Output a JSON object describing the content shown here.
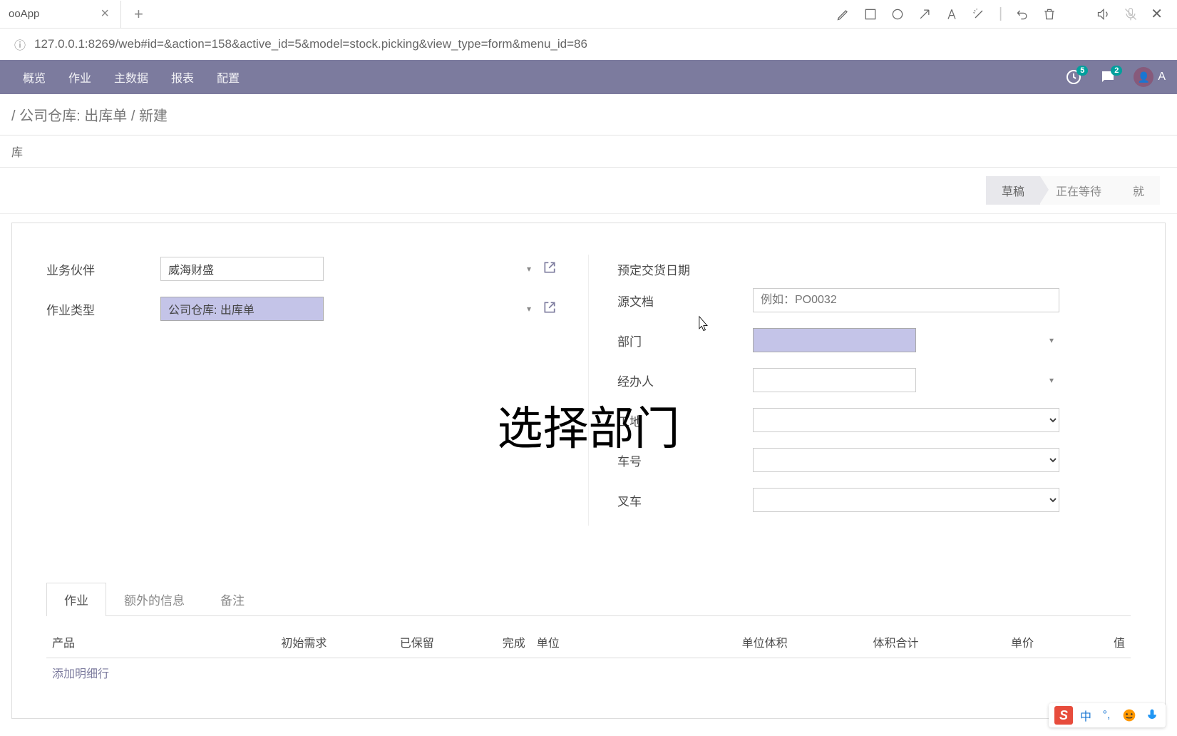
{
  "browser": {
    "tab_title": "ooApp",
    "url": "127.0.0.1:8269/web#id=&action=158&active_id=5&model=stock.picking&view_type=form&menu_id=86"
  },
  "navbar": {
    "items": [
      "概览",
      "作业",
      "主数据",
      "报表",
      "配置"
    ],
    "badge1_count": "5",
    "badge2_count": "2",
    "user_initial": "A"
  },
  "breadcrumb": {
    "path1": "公司仓库: 出库单",
    "sep": " / ",
    "path2": "新建"
  },
  "subbar_text": "库",
  "status": {
    "items": [
      "草稿",
      "正在等待",
      "就"
    ]
  },
  "form": {
    "partner_label": "业务伙伴",
    "partner_value": "威海财盛",
    "operation_type_label": "作业类型",
    "operation_type_value": "公司仓库: 出库单",
    "scheduled_date_label": "预定交货日期",
    "source_doc_label": "源文档",
    "source_doc_placeholder": "例如：PO0032",
    "department_label": "部门",
    "handler_label": "经办人",
    "site_label": "工地",
    "vehicle_label": "车号",
    "forklift_label": "叉车"
  },
  "overlay": "选择部门",
  "tabs": {
    "items": [
      "作业",
      "额外的信息",
      "备注"
    ]
  },
  "table": {
    "headers": {
      "product": "产品",
      "demand": "初始需求",
      "reserved": "已保留",
      "done": "完成",
      "uom": "单位",
      "unit_volume": "单位体积",
      "volume_total": "体积合计",
      "price": "单价",
      "value": "值"
    },
    "add_line": "添加明细行"
  },
  "ime": {
    "logo": "S",
    "lang": "中"
  }
}
